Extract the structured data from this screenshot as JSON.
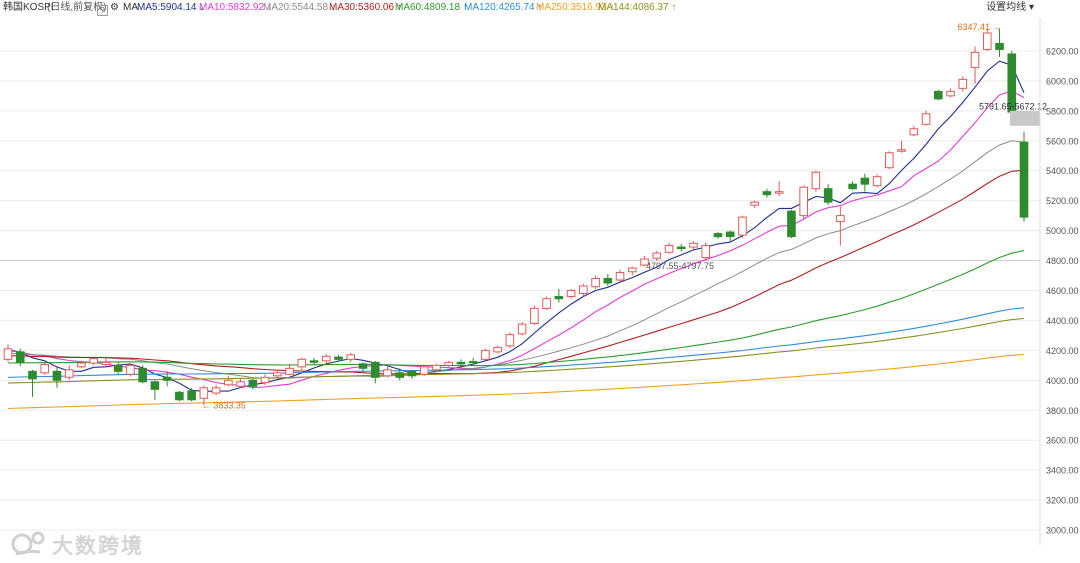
{
  "header": {
    "symbol": "韩国KOSPI",
    "mode": "(日线,前复权)",
    "help_icon": "question-icon",
    "settings_icon": "gear-icon",
    "ma_label": "MA",
    "ma_items": [
      {
        "label": "MA5:5904.14",
        "arrow": "↓",
        "color": "#1f2f8f"
      },
      {
        "label": "MA10:5832.92",
        "arrow": "↓",
        "color": "#e23bd6"
      },
      {
        "label": "MA20:5544.58",
        "arrow": "↓",
        "color": "#8c8c8c"
      },
      {
        "label": "MA30:5360.06",
        "arrow": "↑",
        "color": "#b11f1f"
      },
      {
        "label": "MA60:4809.18",
        "arrow": "↑",
        "color": "#2e9c2e"
      },
      {
        "label": "MA120:4265.74",
        "arrow": "↑",
        "color": "#2f8fd4"
      },
      {
        "label": "MA250:3516.93",
        "arrow": "↑",
        "color": "#f0a020"
      },
      {
        "label": "MA144:4086.37",
        "arrow": "↑",
        "color": "#8f8f1f"
      }
    ],
    "settings_label": "设置均线",
    "settings_caret": "▾"
  },
  "colors": {
    "up": "#e05a5a",
    "down": "#2e8b2e",
    "grid": "#ececec",
    "axis_text": "#555555",
    "annotation": "#e06a1a"
  },
  "watermark": {
    "text": "大数跨境",
    "icon": "logo-icon"
  },
  "chart_data": {
    "type": "candlestick",
    "y_ticks": [
      "6200.00",
      "6000.00",
      "5800.00",
      "5600.00",
      "5400.00",
      "5200.00",
      "5000.00",
      "4800.00",
      "4600.00",
      "4400.00",
      "4200.00",
      "4000.00",
      "3800.00",
      "3600.00",
      "3400.00",
      "3200.00",
      "3000.00"
    ],
    "ylim": [
      2900,
      6420
    ],
    "annotations": {
      "high_label": "6347.41",
      "low_label": "3833.35",
      "mid_label": "4797.55-4797.75",
      "current_label": "5791.65-5672.12",
      "reference_line": 4800
    },
    "candles": [
      [
        4140,
        4210,
        4240,
        4125
      ],
      [
        4190,
        4120,
        4210,
        4095
      ],
      [
        4060,
        4010,
        4070,
        3890
      ],
      [
        4050,
        4105,
        4120,
        4035
      ],
      [
        4060,
        4000,
        4095,
        3950
      ],
      [
        4020,
        4070,
        4100,
        4000
      ],
      [
        4090,
        4115,
        4130,
        4080
      ],
      [
        4115,
        4145,
        4150,
        4100
      ],
      [
        4105,
        4120,
        4160,
        4095
      ],
      [
        4100,
        4060,
        4120,
        4040
      ],
      [
        4040,
        4100,
        4115,
        4025
      ],
      [
        4080,
        3990,
        4100,
        3980
      ],
      [
        3990,
        3940,
        4000,
        3870
      ],
      [
        4020,
        4000,
        4060,
        3960
      ],
      [
        3920,
        3870,
        3930,
        3860
      ],
      [
        3930,
        3870,
        3950,
        3860
      ],
      [
        3880,
        3950,
        3965,
        3833.35
      ],
      [
        3915,
        3950,
        3970,
        3900
      ],
      [
        3970,
        4000,
        4030,
        3960
      ],
      [
        3960,
        3990,
        4010,
        3950
      ],
      [
        4000,
        3960,
        4010,
        3940
      ],
      [
        3985,
        4020,
        4040,
        3970
      ],
      [
        4030,
        4050,
        4070,
        4015
      ],
      [
        4040,
        4080,
        4110,
        4035
      ],
      [
        4090,
        4140,
        4150,
        4070
      ],
      [
        4130,
        4120,
        4150,
        4100
      ],
      [
        4130,
        4160,
        4175,
        4110
      ],
      [
        4155,
        4140,
        4170,
        4125
      ],
      [
        4140,
        4170,
        4185,
        4120
      ],
      [
        4110,
        4080,
        4120,
        4050
      ],
      [
        4120,
        4020,
        4130,
        3980
      ],
      [
        4030,
        4070,
        4090,
        4020
      ],
      [
        4050,
        4020,
        4080,
        4000
      ],
      [
        4060,
        4030,
        4070,
        4010
      ],
      [
        4040,
        4090,
        4100,
        4030
      ],
      [
        4070,
        4100,
        4110,
        4055
      ],
      [
        4100,
        4120,
        4130,
        4090
      ],
      [
        4120,
        4110,
        4140,
        4100
      ],
      [
        4125,
        4120,
        4150,
        4110
      ],
      [
        4140,
        4200,
        4210,
        4135
      ],
      [
        4190,
        4220,
        4230,
        4180
      ],
      [
        4230,
        4305,
        4320,
        4215
      ],
      [
        4310,
        4375,
        4390,
        4300
      ],
      [
        4380,
        4480,
        4500,
        4370
      ],
      [
        4480,
        4545,
        4560,
        4470
      ],
      [
        4560,
        4545,
        4610,
        4520
      ],
      [
        4560,
        4600,
        4610,
        4545
      ],
      [
        4580,
        4630,
        4645,
        4560
      ],
      [
        4625,
        4680,
        4700,
        4610
      ],
      [
        4680,
        4650,
        4710,
        4630
      ],
      [
        4670,
        4720,
        4740,
        4660
      ],
      [
        4725,
        4750,
        4760,
        4700
      ],
      [
        4770,
        4810,
        4830,
        4760
      ],
      [
        4815,
        4850,
        4865,
        4800
      ],
      [
        4855,
        4900,
        4920,
        4845
      ],
      [
        4890,
        4880,
        4910,
        4860
      ],
      [
        4890,
        4915,
        4930,
        4870
      ],
      [
        4820,
        4900,
        4920,
        4797.55
      ],
      [
        4980,
        4960,
        4990,
        4945
      ],
      [
        4990,
        4960,
        5000,
        4930
      ],
      [
        4970,
        5090,
        5100,
        4950
      ],
      [
        5170,
        5190,
        5200,
        5150
      ],
      [
        5260,
        5240,
        5280,
        5220
      ],
      [
        5250,
        5260,
        5330,
        5230
      ],
      [
        5130,
        4960,
        5140,
        4950
      ],
      [
        5100,
        5290,
        5300,
        5080
      ],
      [
        5280,
        5390,
        5400,
        5260
      ],
      [
        5280,
        5190,
        5310,
        5170
      ],
      [
        5060,
        5100,
        5160,
        4900
      ],
      [
        5310,
        5280,
        5330,
        5270
      ],
      [
        5350,
        5310,
        5380,
        5260
      ],
      [
        5300,
        5360,
        5375,
        5290
      ],
      [
        5420,
        5520,
        5530,
        5410
      ],
      [
        5530,
        5540,
        5600,
        5520
      ],
      [
        5640,
        5680,
        5700,
        5630
      ],
      [
        5710,
        5780,
        5800,
        5700
      ],
      [
        5930,
        5880,
        5940,
        5870
      ],
      [
        5900,
        5930,
        5950,
        5890
      ],
      [
        5950,
        6010,
        6030,
        5930
      ],
      [
        6090,
        6190,
        6230,
        5980
      ],
      [
        6210,
        6320,
        6340,
        6200
      ],
      [
        6250,
        6210,
        6347.41,
        6160
      ],
      [
        6180,
        5791.65,
        6200,
        5780
      ],
      [
        5591,
        5090,
        5660,
        5060
      ]
    ]
  }
}
